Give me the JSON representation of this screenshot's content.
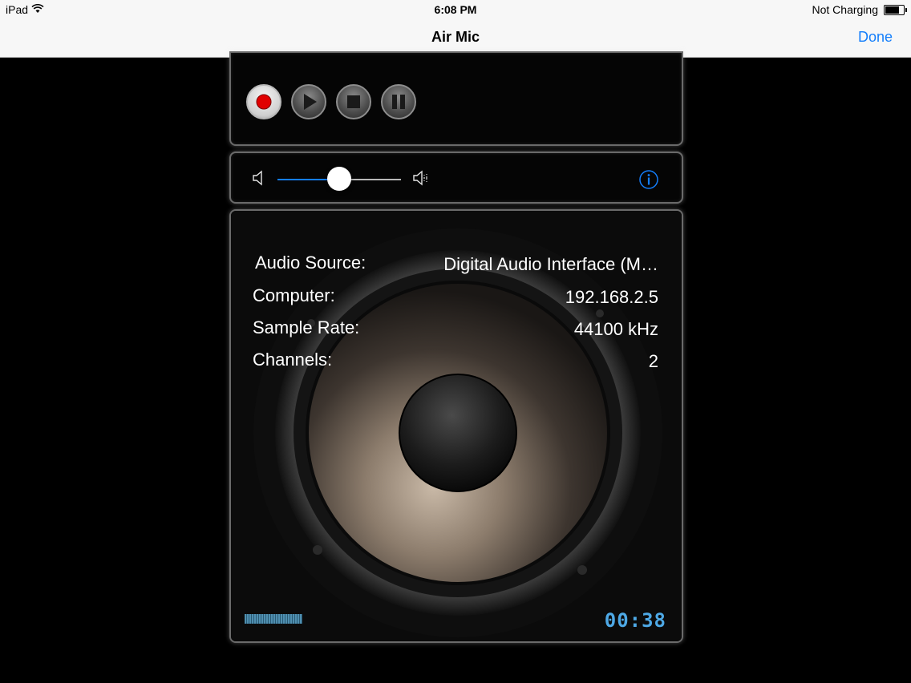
{
  "status_bar": {
    "device": "iPad",
    "time": "6:08 PM",
    "charging": "Not Charging"
  },
  "nav": {
    "title": "Air Mic",
    "done_label": "Done"
  },
  "transport": {
    "buttons": [
      "record",
      "play",
      "stop",
      "pause"
    ]
  },
  "volume": {
    "level": 0.5
  },
  "info": {
    "rows": [
      {
        "label": "Audio Source:",
        "value": "Digital Audio Interface (M…"
      },
      {
        "label": "Computer:",
        "value": "192.168.2.5"
      },
      {
        "label": "Sample Rate:",
        "value": "44100 kHz"
      },
      {
        "label": "Channels:",
        "value": "2"
      }
    ]
  },
  "timer": "00:38",
  "colors": {
    "accent": "#147efb",
    "record": "#e10000",
    "timer": "#4ea9e6"
  }
}
